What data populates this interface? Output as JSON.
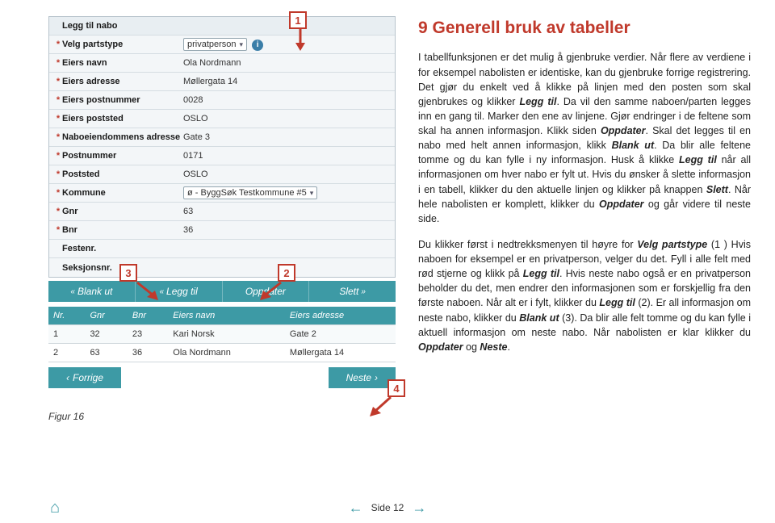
{
  "heading": "9    Generell bruk av tabeller",
  "para1_parts": [
    "I tabellfunksjonen er det mulig å gjenbruke verdier. Når flere av verdiene i for eksempel nabolisten er identiske, kan du gjenbruke forrige registrering. Det gjør du enkelt ved å klikke på linjen med den posten som skal gjenbrukes og klikker ",
    "Legg til",
    ". Da vil den samme naboen/parten legges inn en gang til. Marker den ene av linjene. Gjør endringer i de feltene som skal ha annen informasjon. Klikk siden ",
    "Oppdater",
    ". Skal det legges til en nabo med helt annen informasjon, klikk ",
    "Blank ut",
    ". Da blir alle feltene tomme og du kan fylle i ny informasjon. Husk å klikke ",
    "Legg til",
    " når all informasjonen om hver nabo er fylt ut. Hvis du ønsker å slette informasjon i en tabell, klikker du den aktuelle linjen og klikker på knappen ",
    "Slett",
    ". Når hele nabolisten er komplett, klikker du ",
    "Oppdater",
    " og går videre til neste side."
  ],
  "para2_parts": [
    "Du klikker først i nedtrekksmenyen til høyre for ",
    "Velg partstype",
    " (1 ) Hvis naboen for eksempel er en privatperson, velger du det. Fyll i alle felt med rød stjerne og klikk på ",
    "Legg til",
    ". Hvis neste nabo også er en privatperson beholder du det, men endrer den informasjonen som er forskjellig fra den første naboen. Når alt er i fylt, klikker du ",
    "Legg til",
    " (2). Er all informasjon om neste nabo, klikker du ",
    "Blank ut",
    " (3). Da blir alle felt tomme og du kan fylle i aktuell informasjon om neste nabo. Når nabolisten er klar klikker du ",
    "Oppdater",
    " og ",
    "Neste",
    "."
  ],
  "form": {
    "title_label": "Legg til nabo",
    "rows": [
      {
        "req": "*",
        "label": "Velg partstype",
        "value": "privatperson",
        "dropdown": true,
        "info": true
      },
      {
        "req": "*",
        "label": "Eiers navn",
        "value": "Ola Nordmann"
      },
      {
        "req": "*",
        "label": "Eiers adresse",
        "value": "Møllergata 14"
      },
      {
        "req": "*",
        "label": "Eiers postnummer",
        "value": "0028"
      },
      {
        "req": "*",
        "label": "Eiers poststed",
        "value": "OSLO"
      },
      {
        "req": "*",
        "label": "Naboeiendommens adresse",
        "value": "Gate 3"
      },
      {
        "req": "*",
        "label": "Postnummer",
        "value": "0171"
      },
      {
        "req": "*",
        "label": "Poststed",
        "value": "OSLO"
      },
      {
        "req": "*",
        "label": "Kommune",
        "value": "ø - ByggSøk Testkommune #5",
        "dropdown": true
      },
      {
        "req": "*",
        "label": "Gnr",
        "value": "63"
      },
      {
        "req": "*",
        "label": "Bnr",
        "value": "36"
      },
      {
        "req": "",
        "label": "Festenr.",
        "value": ""
      },
      {
        "req": "",
        "label": "Seksjonsnr.",
        "value": ""
      }
    ]
  },
  "toolbar": {
    "blank_ut": "Blank ut",
    "legg_til": "Legg til",
    "oppdater": "Oppdater",
    "slett": "Slett"
  },
  "table": {
    "headers": [
      "Nr.",
      "Gnr",
      "Bnr",
      "Eiers navn",
      "Eiers adresse"
    ],
    "rows": [
      [
        "1",
        "32",
        "23",
        "Kari Norsk",
        "Gate 2"
      ],
      [
        "2",
        "63",
        "36",
        "Ola Nordmann",
        "Møllergata 14"
      ]
    ]
  },
  "nav": {
    "prev": "Forrige",
    "next": "Neste"
  },
  "figure_caption": "Figur 16",
  "callouts": {
    "c1": "1",
    "c2": "2",
    "c3": "3",
    "c4": "4"
  },
  "footer": {
    "page": "Side 12"
  }
}
